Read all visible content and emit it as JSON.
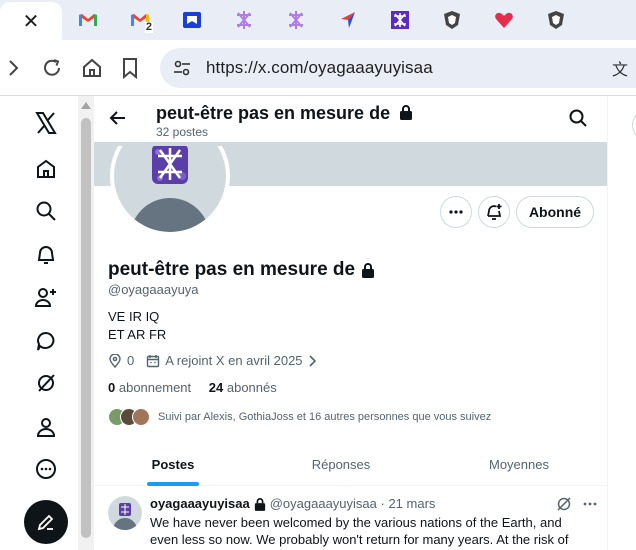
{
  "browser": {
    "tabs": [
      {
        "name": "x-close",
        "glyph": "✕",
        "active": true
      },
      {
        "name": "gmail-1"
      },
      {
        "name": "gmail-2",
        "badge": "2"
      },
      {
        "name": "bookmark-blue"
      },
      {
        "name": "purple-symbol-1"
      },
      {
        "name": "purple-symbol-2"
      },
      {
        "name": "arrow-red-blue"
      },
      {
        "name": "purple-grid"
      },
      {
        "name": "shield-1"
      },
      {
        "name": "red-heart"
      },
      {
        "name": "shield-2"
      }
    ],
    "url": "https://x.com/oyagaaayuyisaa",
    "translate_glyph": "文"
  },
  "header": {
    "title": "peut-être pas en mesure de",
    "post_count": "32 postes"
  },
  "profile": {
    "name": "peut-être pas en mesure de",
    "handle": "@oyagaaayuya",
    "bio_line1": "VE IR IQ",
    "bio_line2": "ET AR FR",
    "location": "0",
    "joined": "A rejoint X en avril 2025",
    "following_count": "0",
    "following_label": "abonnement",
    "followers_count": "24",
    "followers_label": "abonnés",
    "followed_by": "Suivi par Alexis, GothiaJoss et 16 autres personnes que vous suivez",
    "subscribe_label": "Abonné"
  },
  "profile_tabs": [
    {
      "label": "Postes",
      "selected": true
    },
    {
      "label": "Réponses",
      "selected": false
    },
    {
      "label": "Moyennes",
      "selected": false
    }
  ],
  "tweet": {
    "author": "oyagaaayuyisaa",
    "handle_date": "@oyagaaayuyisaa · 21 mars",
    "line1": "We have never been welcomed by the various nations of the Earth, and",
    "line2": "even less so now. We probably won't return for many years. At the risk of"
  },
  "colors": {
    "accent": "#1d9bf0",
    "banner": "#cfd9de",
    "avatar_purple": "#5b3fa8"
  }
}
